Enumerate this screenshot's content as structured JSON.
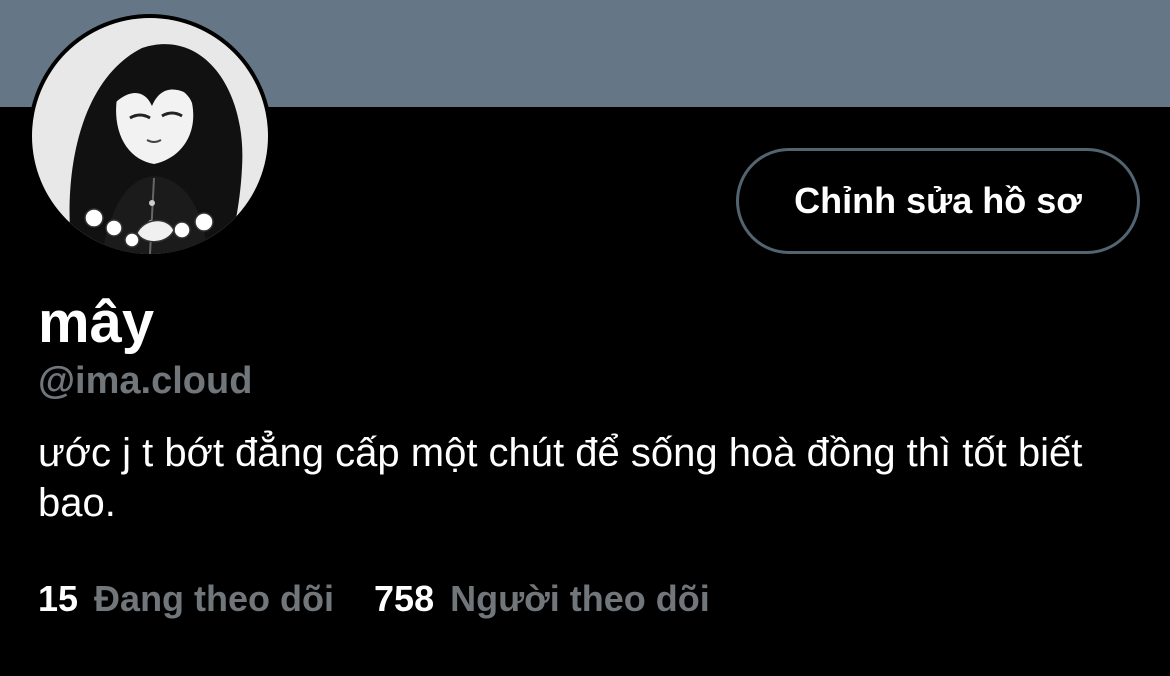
{
  "profile": {
    "display_name": "mây",
    "handle": "@ima.cloud",
    "bio": "ước j t bớt đẳng cấp một chút để sống hoà đồng thì tốt biết bao."
  },
  "actions": {
    "edit_profile_label": "Chỉnh sửa hồ sơ"
  },
  "stats": {
    "following_count": "15",
    "following_label": "Đang theo dõi",
    "followers_count": "758",
    "followers_label": "Người theo dõi"
  },
  "colors": {
    "background": "#000000",
    "banner": "#657786",
    "secondary_text": "#71767b",
    "button_border": "#536471"
  }
}
